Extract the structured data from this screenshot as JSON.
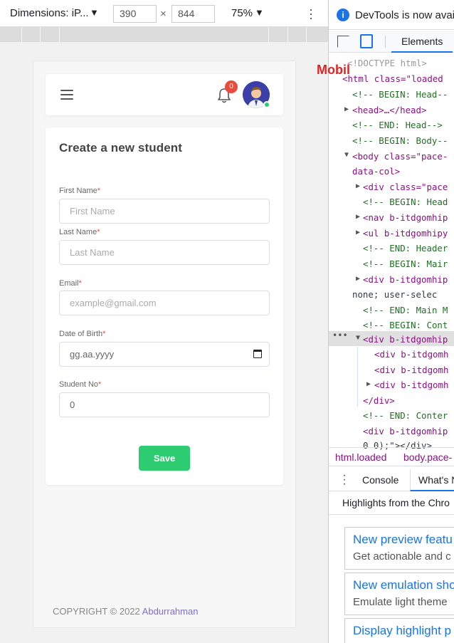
{
  "devtools_toolbar": {
    "dimensions_label": "Dimensions: iP...",
    "caret": "▼",
    "width": "390",
    "times": "×",
    "height": "844",
    "zoom": "75%",
    "menu_icon": "kebab-icon"
  },
  "app": {
    "navbar": {
      "menu_icon": "hamburger-icon",
      "notification_icon": "bell-icon",
      "notification_count": "0",
      "avatar_icon": "user-avatar",
      "status_color": "#2ecc71"
    },
    "form": {
      "title": "Create a new student",
      "required_mark": "*",
      "fields": [
        {
          "label": "First Name",
          "placeholder": "First Name"
        },
        {
          "label": "Last Name",
          "placeholder": "Last Name"
        },
        {
          "label": "Email",
          "placeholder": "example@gmail.com"
        },
        {
          "label": "Date of Birth",
          "placeholder": "gg.aa.yyyy"
        },
        {
          "label": "Student No",
          "value": "0"
        }
      ],
      "save_label": "Save"
    },
    "footer": {
      "copyright": "COPYRIGHT © 2022 ",
      "author": "Abdurrahman"
    }
  },
  "overlay_label": "Mobil",
  "devtools": {
    "info_text": "DevTools is now avail",
    "tabs": {
      "elements": "Elements"
    },
    "dom_lines": [
      "<!DOCTYPE html>",
      "<html class=\"loaded",
      "<!-- BEGIN: Head--",
      "<head>…</head>",
      "<!-- END: Head-->",
      "<!-- BEGIN: Body--",
      "<body class=\"pace-",
      "data-col>",
      "<div class=\"pace",
      "<!-- BEGIN: Head",
      "<nav b-itdgomhip",
      "<ul b-itdgomhipy",
      "<!-- END: Header",
      "<!-- BEGIN: Mair",
      "<div b-itdgomhip",
      "none; user-selec",
      "<!-- END: Main M",
      "<!-- BEGIN: Cont",
      "<div b-itdgomhip",
      "<div b-itdgomh",
      "<div b-itdgomh",
      "<div b-itdgomh",
      "</div>",
      "<!-- END: Conter",
      "<div b-itdgomhip",
      "0 0);\"></div>"
    ],
    "breadcrumbs": [
      "html.loaded",
      "body.pace-"
    ],
    "drawer_tabs": {
      "console": "Console",
      "whats_new": "What's N"
    },
    "highlights_heading": "Highlights from the Chro",
    "news": [
      {
        "title": "New preview featu",
        "desc": "Get actionable and c"
      },
      {
        "title": "New emulation sho",
        "desc": "Emulate light theme"
      },
      {
        "title": "Display highlight p",
        "desc": ""
      }
    ],
    "accent_color": "#1a73e8"
  }
}
